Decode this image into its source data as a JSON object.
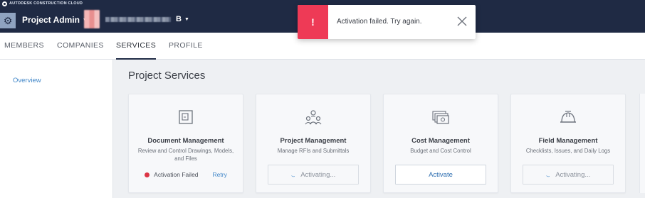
{
  "header": {
    "brand": "AUTODESK CONSTRUCTION CLOUD",
    "brand_icon": "autodesk-logo-icon",
    "settings_icon": "gear-icon",
    "project_admin_label": "Project Admin",
    "account_suffix": "B"
  },
  "tabs": [
    {
      "label": "MEMBERS"
    },
    {
      "label": "COMPANIES"
    },
    {
      "label": "SERVICES",
      "active": true
    },
    {
      "label": "PROFILE"
    }
  ],
  "sidebar": {
    "items": [
      {
        "label": "Overview"
      }
    ]
  },
  "main": {
    "title": "Project Services",
    "cards": [
      {
        "icon": "document-management-icon",
        "title": "Document Management",
        "description": "Review and Control Drawings, Models, and Files",
        "status": "Activation Failed",
        "retry_label": "Retry"
      },
      {
        "icon": "project-management-icon",
        "title": "Project Management",
        "description": "Manage RFIs and Submittals",
        "button_label": "Activating..."
      },
      {
        "icon": "cost-management-icon",
        "title": "Cost Management",
        "description": "Budget and Cost Control",
        "button_label": "Activate"
      },
      {
        "icon": "field-management-icon",
        "title": "Field Management",
        "description": "Checklists, Issues, and Daily Logs",
        "button_label": "Activating..."
      }
    ]
  },
  "toast": {
    "icon": "!",
    "message": "Activation failed. Try again.",
    "close_icon": "close-icon"
  },
  "colors": {
    "header_bg": "#1f2a44",
    "toast_accent": "#ee3a56",
    "link": "#3f86c8",
    "error_dot": "#dc3545"
  }
}
